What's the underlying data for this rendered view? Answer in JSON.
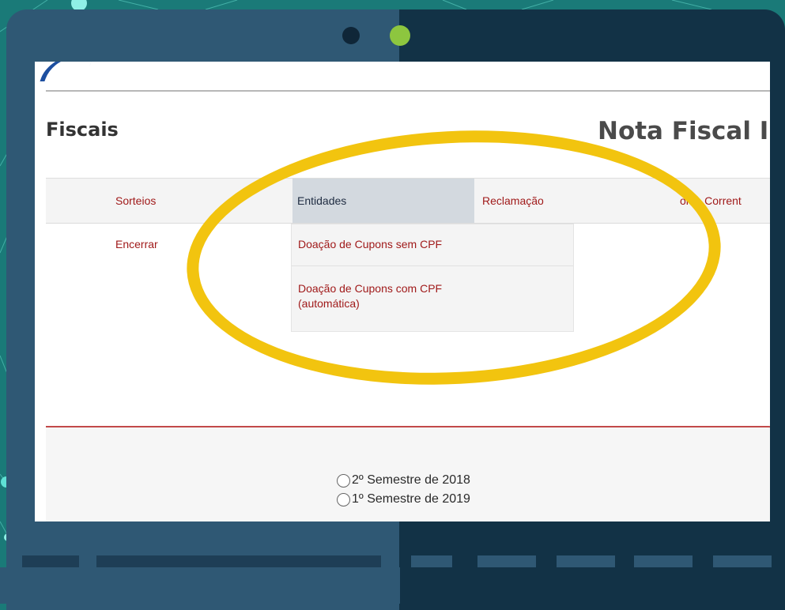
{
  "page": {
    "section_title": "Fiscais",
    "site_title": "Nota Fiscal I"
  },
  "nav": {
    "items": [
      {
        "label": "Sorteios"
      },
      {
        "label": "Entidades"
      },
      {
        "label": "Reclamação"
      },
      {
        "label": "onta Corrent"
      }
    ],
    "row2_item": "Encerrar"
  },
  "dropdown": {
    "items": [
      {
        "label": "Doação de Cupons sem CPF"
      },
      {
        "label": "Doação de Cupons com CPF\n(automática)"
      }
    ]
  },
  "form": {
    "options": [
      {
        "label": "2º Semestre de 2018"
      },
      {
        "label": "1º Semestre de 2019"
      }
    ]
  },
  "colors": {
    "highlight_ellipse": "#f2c40f",
    "link_red": "#a01a1a",
    "frame_blue": "#2f5874",
    "frame_dark": "#123246",
    "accent_green": "#8dc63f"
  }
}
